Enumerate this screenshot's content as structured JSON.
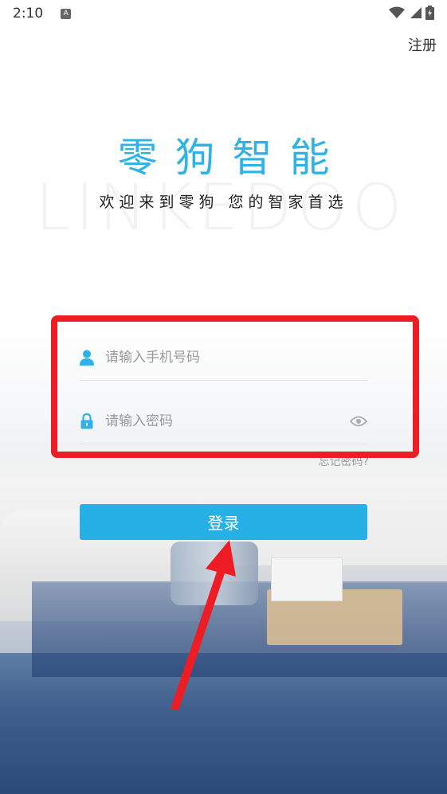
{
  "status_bar": {
    "time": "2:10",
    "notification_badge": "A"
  },
  "header": {
    "register_label": "注册"
  },
  "brand": {
    "title": "零狗智能",
    "watermark": "LINKEDOO",
    "slogan": "欢迎来到零狗  您的智家首选"
  },
  "form": {
    "phone": {
      "placeholder": "请输入手机号码",
      "value": ""
    },
    "password": {
      "placeholder": "请输入密码",
      "value": ""
    },
    "forgot_label": "忘记密码?"
  },
  "login_button": {
    "label": "登录"
  },
  "icons": {
    "user": "user-icon",
    "lock": "lock-icon",
    "eye": "eye-icon",
    "wifi": "wifi-icon",
    "signal": "signal-icon",
    "battery": "battery-icon"
  },
  "colors": {
    "accent": "#25b1e6",
    "brand_title": "#2fb2e6",
    "annotation": "#ee1c24",
    "input_icon": "#2fb2e6"
  }
}
